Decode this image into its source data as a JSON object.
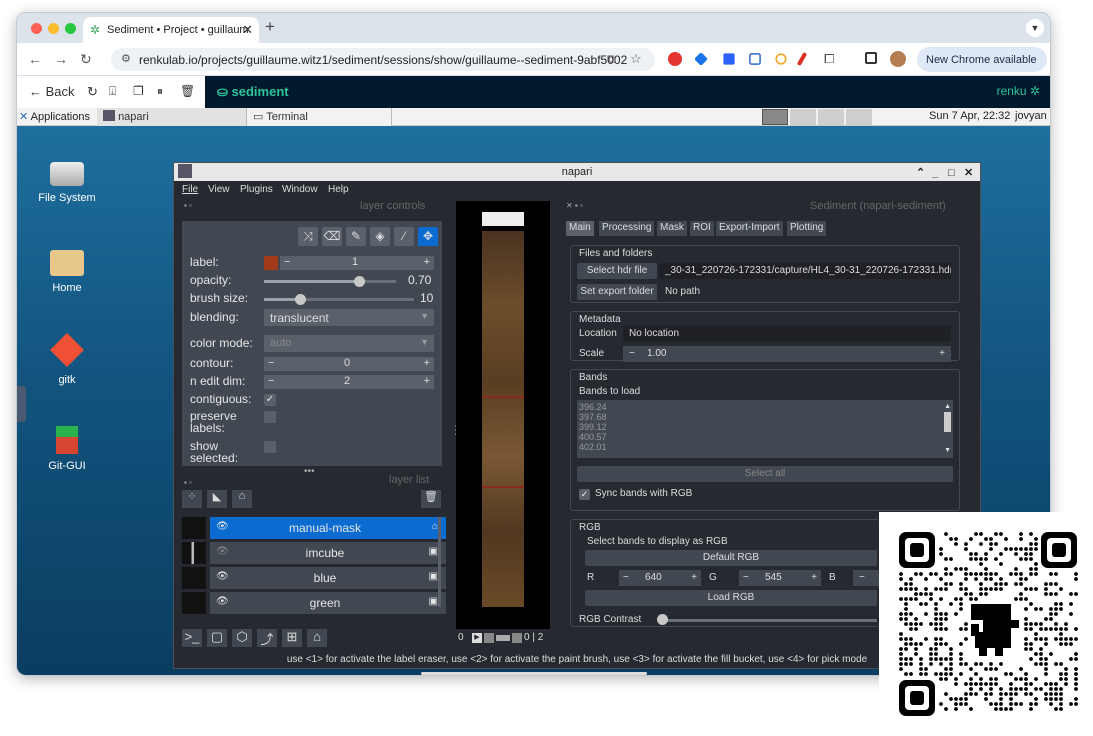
{
  "browser": {
    "tab_title": "Sediment • Project • guillaum",
    "url": "renkulab.io/projects/guillaume.witz1/sediment/sessions/show/guillaume--sediment-9abf5002",
    "new_chrome": "New Chrome available"
  },
  "renku": {
    "back": "Back",
    "project": "sediment",
    "logo": "renku"
  },
  "xfce": {
    "applications": "Applications",
    "task_napari": "napari",
    "task_terminal": "Terminal",
    "clock": "Sun  7 Apr, 22:32",
    "user": "jovyan"
  },
  "desktop_icons": [
    "File System",
    "Home",
    "gitk",
    "Git-GUI"
  ],
  "napari": {
    "title": "napari",
    "menu": [
      "File",
      "View",
      "Plugins",
      "Window",
      "Help"
    ],
    "layer_controls_title": "layer controls",
    "label_label": "label:",
    "label_value": "1",
    "opacity_label": "opacity:",
    "opacity_value": "0.70",
    "brush_label": "brush size:",
    "brush_value": "10",
    "blending_label": "blending:",
    "blending_value": "translucent",
    "color_mode_label": "color mode:",
    "color_mode_value": "auto",
    "contour_label": "contour:",
    "contour_value": "0",
    "n_edit_label": "n edit dim:",
    "n_edit_value": "2",
    "contiguous_label": "contiguous:",
    "preserve_label": "preserve\nlabels:",
    "show_selected_label": "show\nselected:",
    "layer_list_title": "layer list",
    "layers": [
      "manual-mask",
      "imcube",
      "blue",
      "green"
    ],
    "dims_label": "0",
    "dims_max": "0 | 2",
    "status": "use <1> for activate the label eraser, use <2> for activate the paint brush, use <3> for activate the fill bucket, use <4> for pick mode"
  },
  "sediment": {
    "title": "Sediment (napari-sediment)",
    "tabs": [
      "Main",
      "Processing",
      "Mask",
      "ROI",
      "Export-Import",
      "Plotting"
    ],
    "files_group": "Files and folders",
    "select_hdr": "Select hdr file",
    "hdr_path": "_30-31_220726-172331/capture/HL4_30-31_220726-172331.hdr",
    "set_export": "Set export folder",
    "export_path": "No path",
    "metadata_group": "Metadata",
    "location_label": "Location",
    "location_value": "No location",
    "scale_label": "Scale",
    "scale_value": "1.00",
    "bands_group": "Bands",
    "bands_to_load": "Bands to load",
    "band_list": [
      "396.24",
      "397.68",
      "399.12",
      "400.57",
      "402.01"
    ],
    "select_all": "Select all",
    "sync_bands": "Sync bands with RGB",
    "rgb_group": "RGB",
    "select_rgb": "Select bands to display as RGB",
    "default_rgb": "Default RGB",
    "r_label": "R",
    "r_value": "640",
    "g_label": "G",
    "g_value": "545",
    "b_label": "B",
    "load_rgb": "Load RGB",
    "rgb_contrast": "RGB Contrast"
  },
  "colors": {
    "accent": "#0b6bd1",
    "label_swatch": "#a33a1a",
    "renku_green": "#2bc49a"
  }
}
